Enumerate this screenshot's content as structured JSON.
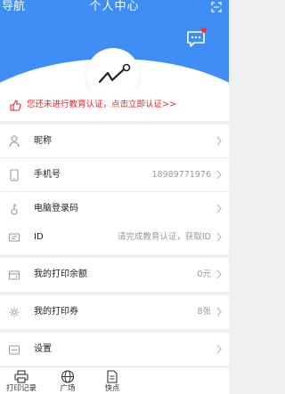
{
  "header": {
    "nav_label": "导航",
    "title": "个人中心",
    "scan_icon": "scan-icon",
    "message_icon": "message-icon",
    "message_badge_color": "#ff2d2d",
    "bg_color": "#3f8ef5"
  },
  "notice": {
    "text": "您还未进行教育认证，点击立即认证>>",
    "color": "#e8262c"
  },
  "profile_rows": [
    {
      "label": "昵称",
      "value": "",
      "icon": "person-icon"
    },
    {
      "label": "手机号",
      "value": "18989771976",
      "icon": "phone-icon"
    },
    {
      "label": "电脑登录码",
      "value": "",
      "icon": "key-icon"
    }
  ],
  "id_row": {
    "label": "ID",
    "value": "请完成教育认证，获取ID",
    "icon": "id-card-icon"
  },
  "balance_row": {
    "label": "我的打印余额",
    "value": "0元",
    "icon": "wallet-icon"
  },
  "coupon_row": {
    "label": "我的打印券",
    "value": "8张",
    "icon": "coupon-gear-icon"
  },
  "settings_row": {
    "label": "设置",
    "value": "",
    "icon": "settings-icon"
  },
  "tabbar": {
    "items": [
      {
        "label": "打印记录",
        "icon": "printer-icon"
      },
      {
        "label": "广场",
        "icon": "globe-icon"
      },
      {
        "label": "快点",
        "icon": "document-icon"
      }
    ]
  }
}
